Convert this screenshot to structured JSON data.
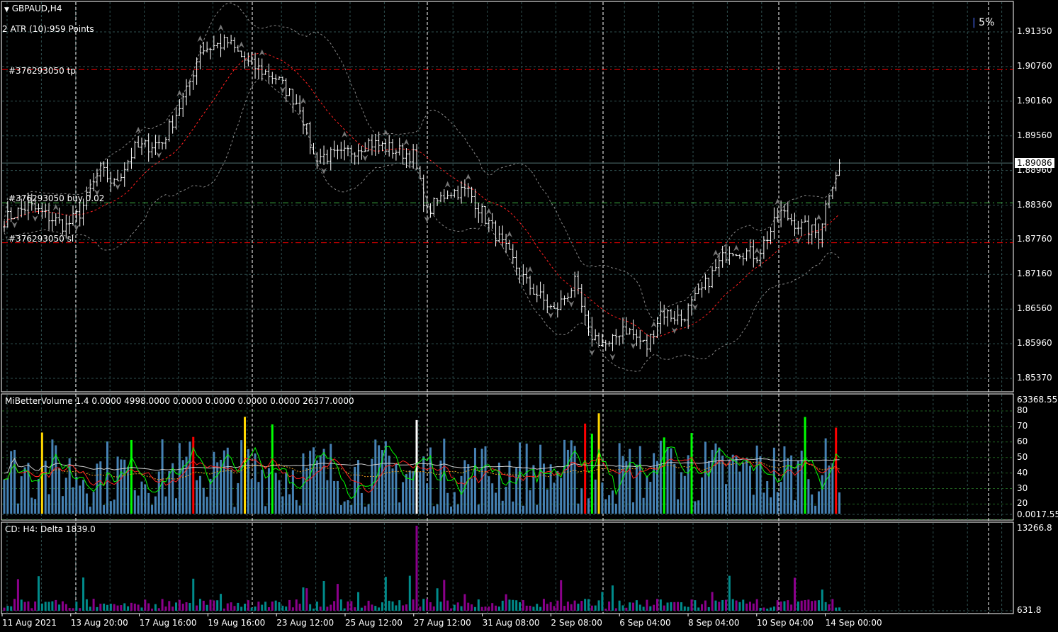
{
  "window": {
    "symbol_title": "GBPAUD,H4",
    "menu_icon": "triangle-down-icon"
  },
  "indicators": {
    "atr_label": "2 ATR (10):959 Points",
    "percent_label": "5%",
    "volume_label": "MiBetterVolume 1.4 0.0000 4998.0000 0.0000 0.0000 0.0000 0.0000 26377.0000",
    "delta_label": "CD: H4: Delta  1839.0"
  },
  "orders": {
    "tp_label": "#376293050 tp",
    "buy_label": "#376293050 buy 0.02",
    "sl_label": "#376293050 sl",
    "tp_price": 1.907,
    "buy_price": 1.884,
    "sl_price": 1.8771
  },
  "price_axis": {
    "ticks": [
      "1.91350",
      "1.90760",
      "1.90160",
      "1.89560",
      "1.88960",
      "1.88360",
      "1.87760",
      "1.87160",
      "1.86560",
      "1.85960",
      "1.85370"
    ],
    "current_price": "1.89086"
  },
  "volume_axis": {
    "top": "63368.55",
    "ticks": [
      "80",
      "70",
      "60",
      "50",
      "40",
      "30",
      "20"
    ],
    "bottom": "0.0017.55"
  },
  "delta_axis": {
    "top": "13266.8",
    "bottom": "631.8"
  },
  "time_axis": [
    "11 Aug 2021",
    "13 Aug 20:00",
    "17 Aug 16:00",
    "19 Aug 16:00",
    "23 Aug 12:00",
    "25 Aug 12:00",
    "27 Aug 12:00",
    "31 Aug 08:00",
    "2 Sep 08:00",
    "6 Sep 04:00",
    "8 Sep 04:00",
    "10 Sep 04:00",
    "14 Sep 00:00"
  ],
  "colors": {
    "background": "#000000",
    "bars": "#ffffff",
    "grid": "#2f4f4f",
    "volume": "#4682b4",
    "volume_up": "#00ff00",
    "volume_down": "#ff0000",
    "volume_low": "#ffd700",
    "delta_pos": "#008b8b",
    "delta_neg": "#8b008b",
    "tp_sl": "#ff0000",
    "buy": "#3cb043",
    "ma": "#ff2020"
  },
  "chart_data": {
    "type": "ohlc",
    "timeframe": "H4",
    "close_path": [
      [
        0,
        1.8811
      ],
      [
        7,
        1.8835
      ],
      [
        18,
        1.8799
      ],
      [
        22,
        1.8823
      ],
      [
        28,
        1.8897
      ],
      [
        32,
        1.8872
      ],
      [
        38,
        1.8933
      ],
      [
        46,
        1.8945
      ],
      [
        53,
        1.9031
      ],
      [
        57,
        1.9104
      ],
      [
        65,
        1.9117
      ],
      [
        71,
        1.908
      ],
      [
        79,
        1.9056
      ],
      [
        86,
        1.9007
      ],
      [
        90,
        1.8921
      ],
      [
        98,
        1.8921
      ],
      [
        106,
        1.8945
      ],
      [
        119,
        1.8921
      ],
      [
        123,
        1.8823
      ],
      [
        129,
        1.886
      ],
      [
        135,
        1.886
      ],
      [
        143,
        1.8786
      ],
      [
        152,
        1.8701
      ],
      [
        160,
        1.8652
      ],
      [
        166,
        1.8701
      ],
      [
        170,
        1.8615
      ],
      [
        176,
        1.8591
      ],
      [
        180,
        1.8627
      ],
      [
        187,
        1.8591
      ],
      [
        191,
        1.8652
      ],
      [
        197,
        1.864
      ],
      [
        203,
        1.8689
      ],
      [
        211,
        1.8762
      ],
      [
        219,
        1.875
      ],
      [
        226,
        1.8823
      ],
      [
        232,
        1.8799
      ],
      [
        237,
        1.8786
      ],
      [
        240,
        1.886
      ],
      [
        243,
        1.8909
      ]
    ],
    "ylim": [
      1.852,
      1.918
    ]
  }
}
